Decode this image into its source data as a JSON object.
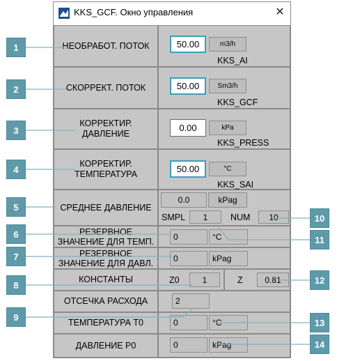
{
  "window": {
    "title": "KKS_GCF. Окно управления",
    "close_glyph": "✕"
  },
  "rows": {
    "raw_flow": {
      "label": "НЕОБРАБОТ. ПОТОК",
      "value": "50.00",
      "unit": "m3/h",
      "tag": "KKS_AI"
    },
    "corr_flow": {
      "label": "СКОРРЕКТ. ПОТОК",
      "value": "50.00",
      "unit": "Sm3/h",
      "tag": "KKS_GCF"
    },
    "corr_pressure": {
      "label_line1": "КОРРЕКТИР.",
      "label_line2": "ДАВЛЕНИЕ",
      "value": "0.00",
      "unit": "kPa",
      "tag": "KKS_PRESS"
    },
    "corr_temp": {
      "label_line1": "КОРРЕКТИР.",
      "label_line2": "ТЕМПЕРАТУРА",
      "value": "50.00",
      "unit": "°C",
      "tag": "KKS_SAI"
    },
    "avg_pressure": {
      "label": "СРЕДНЕЕ ДАВЛЕНИЕ",
      "value": "0.0",
      "unit": "kPag",
      "smpl_label": "SMPL",
      "smpl_value": "1",
      "num_label": "NUM",
      "num_value": "10"
    },
    "backup_temp": {
      "label_line1": "РЕЗЕРВНОЕ",
      "label_line2": "ЗНАЧЕНИЕ ДЛЯ ТЕМП.",
      "value": "0",
      "unit": "°C"
    },
    "backup_pressure": {
      "label_line1": "РЕЗЕРВНОЕ",
      "label_line2": "ЗНАЧЕНИЕ ДЛЯ ДАВЛ.",
      "value": "0",
      "unit": "kPag"
    },
    "constants": {
      "label": "КОНСТАНТЫ",
      "z0_label": "Z0",
      "z0_value": "1",
      "z_label": "Z",
      "z_value": "0.81"
    },
    "flow_cutoff": {
      "label": "ОТСЕЧКА РАСХОДА",
      "value": "2"
    },
    "temp_t0": {
      "label": "ТЕМПЕРАТУРА T0",
      "value": "0",
      "unit": "°C"
    },
    "pressure_p0": {
      "label": "ДАВЛЕНИЕ P0",
      "value": "0",
      "unit": "kPag"
    }
  },
  "callouts": [
    "1",
    "2",
    "3",
    "4",
    "5",
    "6",
    "7",
    "8",
    "9",
    "10",
    "11",
    "12",
    "13",
    "14"
  ],
  "colors": {
    "badge": "#5f9aaa",
    "panel": "#c6c6c6",
    "focus": "#3a9fb8"
  }
}
